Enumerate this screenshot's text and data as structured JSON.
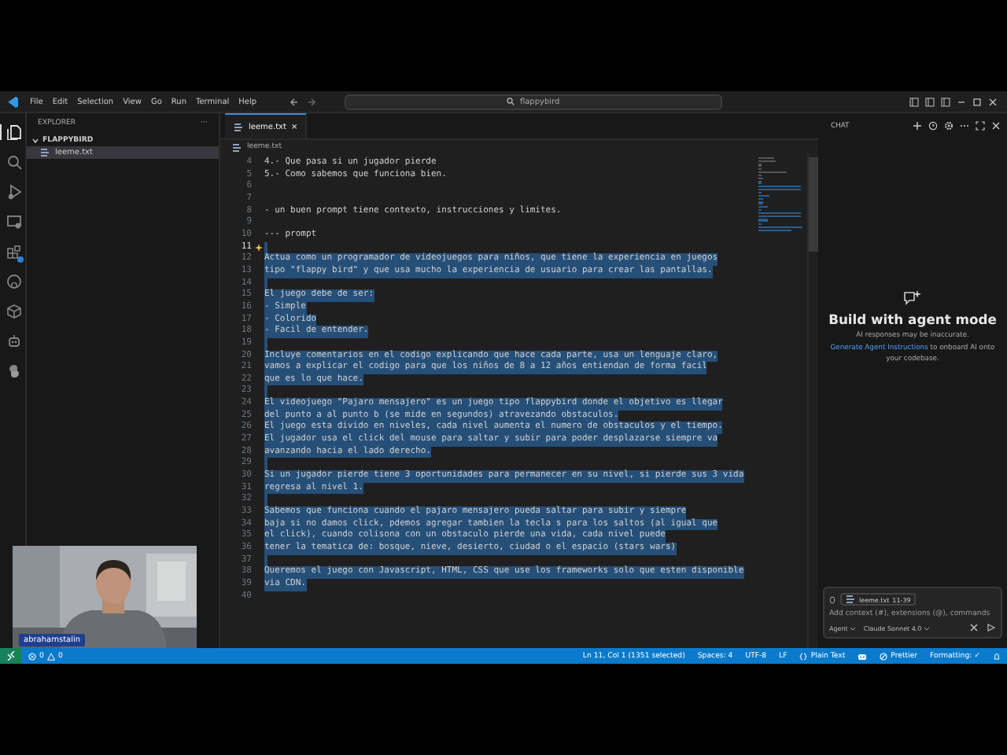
{
  "title_bar": {
    "menus": [
      "File",
      "Edit",
      "Selection",
      "View",
      "Go",
      "Run",
      "Terminal",
      "Help"
    ],
    "search": "flappybird"
  },
  "activity_bar": [
    {
      "kind": "files",
      "selected": true
    },
    {
      "kind": "search",
      "selected": false
    },
    {
      "kind": "debug",
      "selected": false
    },
    {
      "kind": "remote",
      "selected": false
    },
    {
      "kind": "extensions",
      "selected": false
    },
    {
      "kind": "github",
      "selected": false
    },
    {
      "kind": "cube",
      "selected": false
    },
    {
      "kind": "robot",
      "selected": false
    },
    {
      "kind": "python",
      "selected": false
    }
  ],
  "sidebar": {
    "title": "EXPLORER",
    "more": "···",
    "folder": {
      "name": "FLAPPYBIRD",
      "expanded": true,
      "files": [
        {
          "name": "leeme.txt",
          "selected": true
        }
      ]
    }
  },
  "editor": {
    "tabs": [
      {
        "label": "leeme.txt",
        "selected": true,
        "close": "×"
      }
    ],
    "breadcrumb": "leeme.txt",
    "lines": [
      {
        "n": "4",
        "text": "4.- Que pasa si un jugador pierde",
        "selected": false,
        "cursor": false
      },
      {
        "n": "5",
        "text": "5.- Como sabemos que funciona bien.",
        "selected": false,
        "cursor": false
      },
      {
        "n": "6",
        "selected": false,
        "cursor": false
      },
      {
        "n": "7",
        "selected": false,
        "cursor": false
      },
      {
        "n": "8",
        "text": "- un buen prompt tiene contexto, instrucciones y limites.",
        "selected": false,
        "cursor": false
      },
      {
        "n": "9",
        "selected": false,
        "cursor": false
      },
      {
        "n": "10",
        "text": "--- prompt",
        "selected": false,
        "cursor": false
      },
      {
        "n": "11",
        "selected": true,
        "cursor": true
      },
      {
        "n": "12",
        "text": "Actua como un programador de videojuegos para niños, que tiene la experiencia en juegos",
        "selected": true,
        "cursor": false
      },
      {
        "n": "13",
        "text": "tipo \"flappy bird\" y que usa mucho la experiencia de usuario para crear las pantallas.",
        "selected": true,
        "cursor": false
      },
      {
        "n": "14",
        "selected": true,
        "cursor": false
      },
      {
        "n": "15",
        "text": "El juego debe de ser:",
        "selected": true,
        "cursor": false
      },
      {
        "n": "16",
        "text": "- Simple",
        "selected": true,
        "cursor": false
      },
      {
        "n": "17",
        "text": "- Colorido",
        "selected": true,
        "cursor": false
      },
      {
        "n": "18",
        "text": "- Facil de entender.",
        "selected": true,
        "cursor": false
      },
      {
        "n": "19",
        "selected": true,
        "cursor": false
      },
      {
        "n": "20",
        "text": "Incluye comentarios en el codigo explicando que hace cada parte, usa un lenguaje claro,",
        "selected": true,
        "cursor": false
      },
      {
        "n": "21",
        "text": "vamos a explicar el codigo para que los niños de 8 a 12 años entiendan de forma facil",
        "selected": true,
        "cursor": false
      },
      {
        "n": "22",
        "text": "que es lo que hace.",
        "selected": true,
        "cursor": false
      },
      {
        "n": "23",
        "selected": true,
        "cursor": false
      },
      {
        "n": "24",
        "text": "El videojuego \"Pajaro mensajero\" es un juego tipo flappybird donde el objetivo es llegar",
        "selected": true,
        "cursor": false
      },
      {
        "n": "25",
        "text": "del punto a al punto b (se mide en segundos) atravezando obstaculos.",
        "selected": true,
        "cursor": false
      },
      {
        "n": "26",
        "text": "El juego esta divido en niveles, cada nivel aumenta el numero de obstaculos y el tiempo.",
        "selected": true,
        "cursor": false
      },
      {
        "n": "27",
        "text": "El jugador usa el click del mouse para saltar y subir para poder desplazarse siempre va",
        "selected": true,
        "cursor": false
      },
      {
        "n": "28",
        "text": "avanzando hacia el lado derecho.",
        "selected": true,
        "cursor": false
      },
      {
        "n": "29",
        "selected": true,
        "cursor": false
      },
      {
        "n": "30",
        "text": "Si un jugador pierde tiene 3 oportunidades para permanecer en su nivel, si pierde sus 3 vida",
        "selected": true,
        "cursor": false
      },
      {
        "n": "31",
        "text": "regresa al nivel 1.",
        "selected": true,
        "cursor": false
      },
      {
        "n": "32",
        "selected": true,
        "cursor": false
      },
      {
        "n": "33",
        "text": "Sabemos que funciona cuando el pajaro mensajero pueda saltar para subir y siempre",
        "selected": true,
        "cursor": false
      },
      {
        "n": "34",
        "text": "baja si no damos click, pdemos agregar tambien la tecla s para los saltos (al igual que",
        "selected": true,
        "cursor": false
      },
      {
        "n": "35",
        "text": "el click), cuando colisona con un obstaculo pierde una vida, cada nivel puede",
        "selected": true,
        "cursor": false
      },
      {
        "n": "36",
        "text": "tener la tematica de: bosque, nieve, desierto, ciudad o el espacio (stars wars)",
        "selected": true,
        "cursor": false
      },
      {
        "n": "37",
        "selected": true,
        "cursor": false
      },
      {
        "n": "38",
        "text": "Queremos el juego con Javascript, HTML, CSS que use los frameworks solo que esten disponible",
        "selected": true,
        "cursor": false
      },
      {
        "n": "39",
        "text": "via CDN.",
        "selected": true,
        "cursor": false
      },
      {
        "n": "40",
        "selected": false,
        "cursor": false
      }
    ]
  },
  "chat": {
    "title": "CHAT",
    "heading": "Build with agent mode",
    "disclaimer": "AI responses may be inaccurate.",
    "link": "Generate Agent Instructions",
    "link_rest": " to onboard AI onto your codebase.",
    "input": {
      "chip": "leeme.txt",
      "chip_range": "11-39",
      "placeholder": "Add context (#), extensions (@), commands",
      "mode": "Agent",
      "model": "Claude Sonnet 4.0"
    }
  },
  "status_bar": {
    "errors": "0",
    "warnings": "0",
    "items": [
      {
        "kind": "text",
        "text": "Ln 11, Col 1 (1351 selected)"
      },
      {
        "kind": "text",
        "text": "Spaces: 4"
      },
      {
        "kind": "text",
        "text": "UTF-8"
      },
      {
        "kind": "text",
        "text": "LF"
      },
      {
        "kind": "language",
        "text": "Plain Text"
      },
      {
        "kind": "copilot"
      },
      {
        "kind": "prettier",
        "text": "Prettier"
      },
      {
        "kind": "text",
        "text": "Formatting: ✓"
      },
      {
        "kind": "bell"
      }
    ]
  },
  "webcam": {
    "kind": "picture",
    "name_tag": "abrahamstalin"
  }
}
